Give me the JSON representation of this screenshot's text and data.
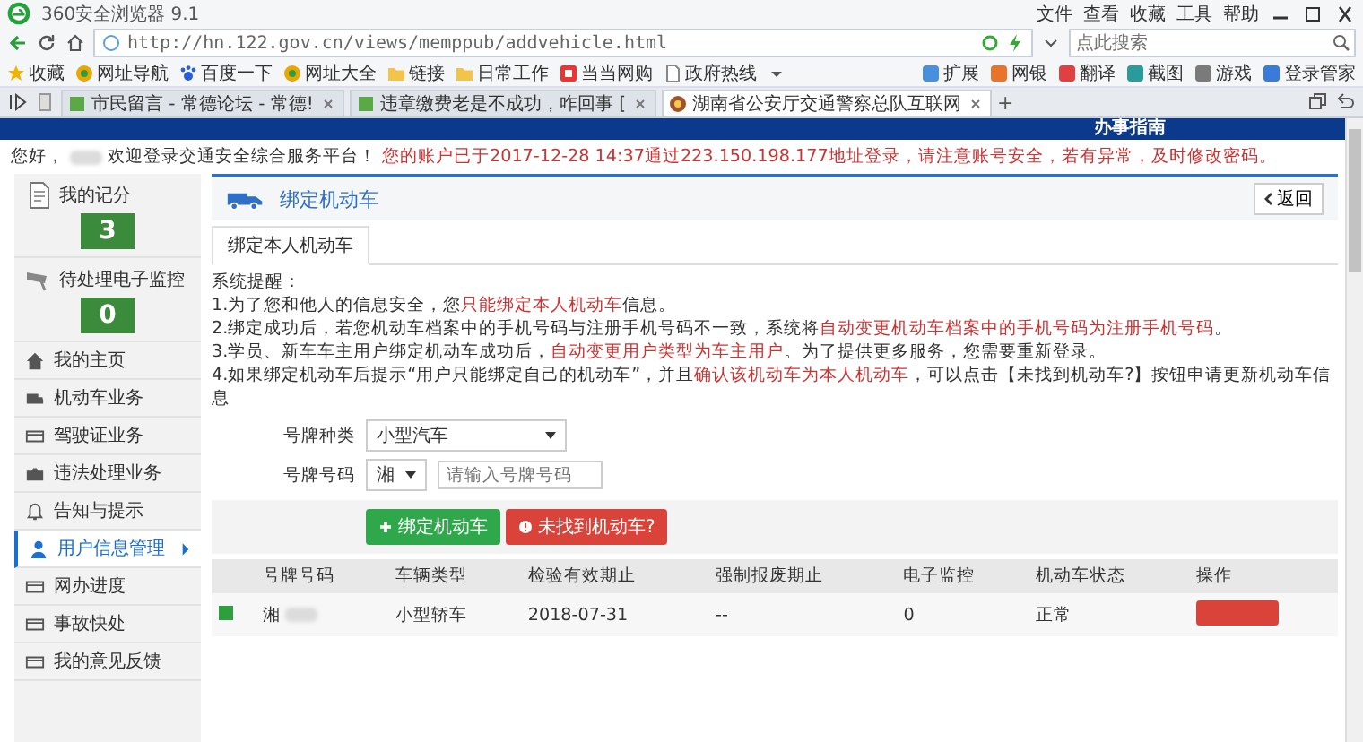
{
  "browser": {
    "title": "360安全浏览器 9.1",
    "menu": [
      "文件",
      "查看",
      "收藏",
      "工具",
      "帮助"
    ],
    "url": "http://hn.122.gov.cn/views/memppub/addvehicle.html",
    "search": {
      "placeholder": "点此搜索"
    },
    "bookmarks": [
      {
        "label": "收藏",
        "kind": "star"
      },
      {
        "label": "网址导航",
        "kind": "site"
      },
      {
        "label": "百度一下",
        "kind": "paw"
      },
      {
        "label": "网址大全",
        "kind": "site"
      },
      {
        "label": "链接",
        "kind": "folder"
      },
      {
        "label": "日常工作",
        "kind": "folder"
      },
      {
        "label": "当当网购",
        "kind": "shop"
      },
      {
        "label": "政府热线",
        "kind": "page"
      }
    ],
    "tools": [
      "扩展",
      "网银",
      "翻译",
      "截图",
      "游戏",
      "登录管家"
    ],
    "tabs": [
      {
        "label": "市民留言 - 常德论坛 - 常德!",
        "selected": false
      },
      {
        "label": "违章缴费老是不成功，咋回事 [",
        "selected": false
      },
      {
        "label": "湖南省公安厅交通警察总队互联网",
        "selected": true
      }
    ],
    "new_tab": "+"
  },
  "page": {
    "header_link": "办事指南",
    "greeting": {
      "hello": "您好，",
      "welcome": "欢迎登录交通安全综合服务平台！",
      "notice": "您的账户已于2017-12-28 14:37通过223.150.198.177地址登录，请注意账号安全，若有异常，及时修改密码。"
    },
    "sidebar": {
      "stats": [
        {
          "label": "我的记分",
          "value": "3"
        },
        {
          "label": "待处理电子监控",
          "value": "0"
        }
      ],
      "items": [
        {
          "label": "我的主页",
          "selected": false
        },
        {
          "label": "机动车业务",
          "selected": false
        },
        {
          "label": "驾驶证业务",
          "selected": false
        },
        {
          "label": "违法处理业务",
          "selected": false
        },
        {
          "label": "告知与提示",
          "selected": false
        },
        {
          "label": "用户信息管理",
          "selected": true
        },
        {
          "label": "网办进度",
          "selected": false
        },
        {
          "label": "事故快处",
          "selected": false
        },
        {
          "label": "我的意见反馈",
          "selected": false
        }
      ]
    },
    "panel": {
      "title": "绑定机动车",
      "back": "返回",
      "tabs": [
        {
          "label": "绑定本人机动车",
          "selected": true
        }
      ],
      "notice_title": "系统提醒：",
      "notices": [
        "1.为了您和他人的信息安全，您**只能绑定本人机动车**信息。",
        "2.绑定成功后，若您机动车档案中的手机号码与注册手机号码不一致，系统将**自动变更机动车档案中的手机号码为注册手机号码**。",
        "3.学员、新车车主用户绑定机动车成功后，**自动变更用户类型为车主用户**。为了提供更多服务，您需要重新登录。",
        "4.如果绑定机动车后提示“用户只能绑定自己的机动车”，并且**确认该机动车为本人机动车**，可以点击【未找到机动车?】按钮申请更新机动车信息"
      ],
      "form": {
        "plate_type": {
          "label": "号牌种类",
          "value": "小型汽车"
        },
        "plate_number": {
          "label": "号牌号码",
          "province": "湘",
          "placeholder": "请输入号牌号码"
        }
      },
      "buttons": {
        "bind": "绑定机动车",
        "not_found": "未找到机动车?"
      },
      "table": {
        "columns": [
          "号牌号码",
          "车辆类型",
          "检验有效期止",
          "强制报废期止",
          "电子监控",
          "机动车状态",
          "操作"
        ],
        "rows": [
          {
            "color": "#2e9e3e",
            "plate": "湘",
            "type": "小型轿车",
            "inspection": "2018-07-31",
            "scrap": "--",
            "monitor": "0",
            "status": "正常"
          }
        ]
      }
    }
  }
}
